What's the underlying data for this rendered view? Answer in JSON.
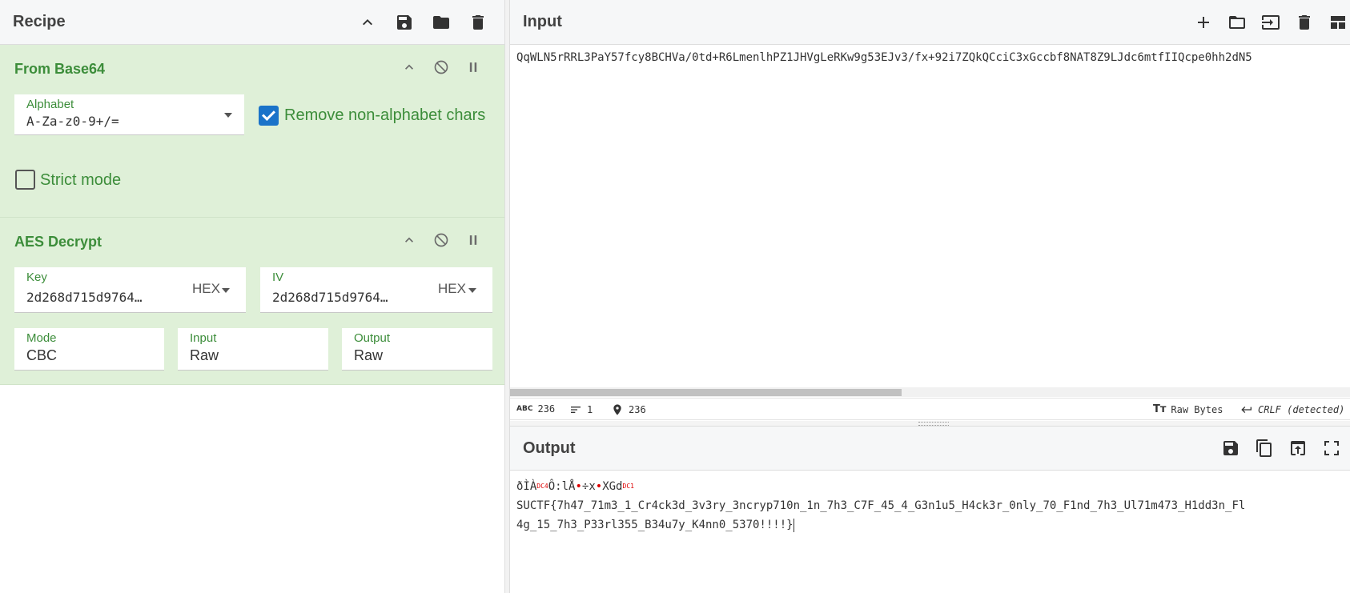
{
  "recipe": {
    "title": "Recipe",
    "icons": [
      "chevron-up-icon",
      "save-icon",
      "folder-icon",
      "trash-icon"
    ]
  },
  "operations": [
    {
      "name": "From Base64",
      "alphabet_label": "Alphabet",
      "alphabet_value": "A-Za-z0-9+/=",
      "remove_nonalpha_label": "Remove non-alphabet chars",
      "remove_nonalpha_checked": true,
      "strict_mode_label": "Strict mode",
      "strict_mode_checked": false
    },
    {
      "name": "AES Decrypt",
      "key_label": "Key",
      "key_value": "2d268d715d9764…",
      "key_format": "HEX",
      "iv_label": "IV",
      "iv_value": "2d268d715d9764…",
      "iv_format": "HEX",
      "mode_label": "Mode",
      "mode_value": "CBC",
      "input_label": "Input",
      "input_value": "Raw",
      "output_label": "Output",
      "output_value": "Raw"
    }
  ],
  "input": {
    "title": "Input",
    "text": "QqWLN5rRRL3PaY57fcy8BCHVa/0td+R6LmenlhPZ1JHVgLeRKw9g53EJv3/fx+92i7ZQkQCciC3xGccbf8NAT8Z9LJdc6mtfIIQcpe0hh2dN5",
    "icons": [
      "plus-icon",
      "folder-icon",
      "import-icon",
      "trash-icon",
      "layout-icon"
    ]
  },
  "status": {
    "length": "236",
    "lines": "1",
    "position": "236",
    "encoding": "Raw Bytes",
    "eol": "CRLF (detected)"
  },
  "output": {
    "title": "Output",
    "line1_a": "ðÌÀ",
    "line1_ctl1": "DC4",
    "line1_b": "Ô:lÅ",
    "line1_c": "÷x",
    "line1_d": "XGd",
    "line1_ctl2": "DC1",
    "line2": "SUCTF{7h47_71m3_1_Cr4ck3d_3v3ry_3ncryp710n_1n_7h3_C7F_45_4_G3n1u5_H4ck3r_0nly_70_F1nd_7h3_Ul71m473_H1dd3n_Fl",
    "line3": "4g_15_7h3_P33rl355_B34u7y_K4nn0_5370!!!!}",
    "icons": [
      "save-icon",
      "copy-icon",
      "replace-input-icon",
      "maximise-icon"
    ]
  }
}
